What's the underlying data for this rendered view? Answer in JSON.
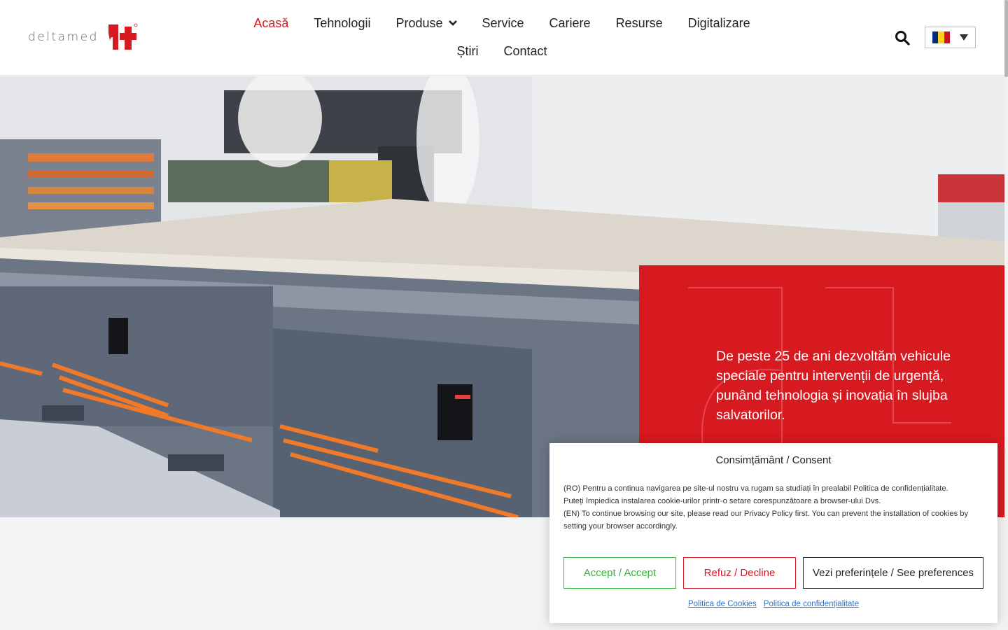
{
  "brand": {
    "name": "deltamed",
    "accent_color": "#d71920"
  },
  "nav": {
    "items": [
      {
        "label": "Acasă",
        "active": true
      },
      {
        "label": "Tehnologii"
      },
      {
        "label": "Produse",
        "has_dropdown": true
      },
      {
        "label": "Service"
      },
      {
        "label": "Cariere"
      },
      {
        "label": "Resurse"
      },
      {
        "label": "Digitalizare"
      },
      {
        "label": "Știri"
      },
      {
        "label": "Contact"
      }
    ]
  },
  "header": {
    "search_icon": "search-icon",
    "language_flag": "romania-flag"
  },
  "hero": {
    "tagline": "De peste 25 de ani dezvoltăm vehicule speciale pentru intervenții de urgență, punând tehnologia și inovația în slujba salvatorilor."
  },
  "consent": {
    "title": "Consimțământ / Consent",
    "body_ro_1": "(RO) Pentru a continua navigarea pe site-ul nostru va rugam sa studiați în prealabil Politica de confidențialitate.",
    "body_ro_2": "Puteți împiedica instalarea cookie-urilor printr-o setare corespunzătoare a browser-ului Dvs.",
    "body_en": "(EN) To continue browsing our site, please read our Privacy Policy first. You can prevent the installation of cookies by setting your browser accordingly.",
    "accept_label": "Accept / Accept",
    "decline_label": "Refuz / Decline",
    "prefs_label": "Vezi preferințele / See preferences",
    "cookie_policy_link": "Politica de Cookies",
    "privacy_policy_link": "Politica de confidențialitate"
  }
}
